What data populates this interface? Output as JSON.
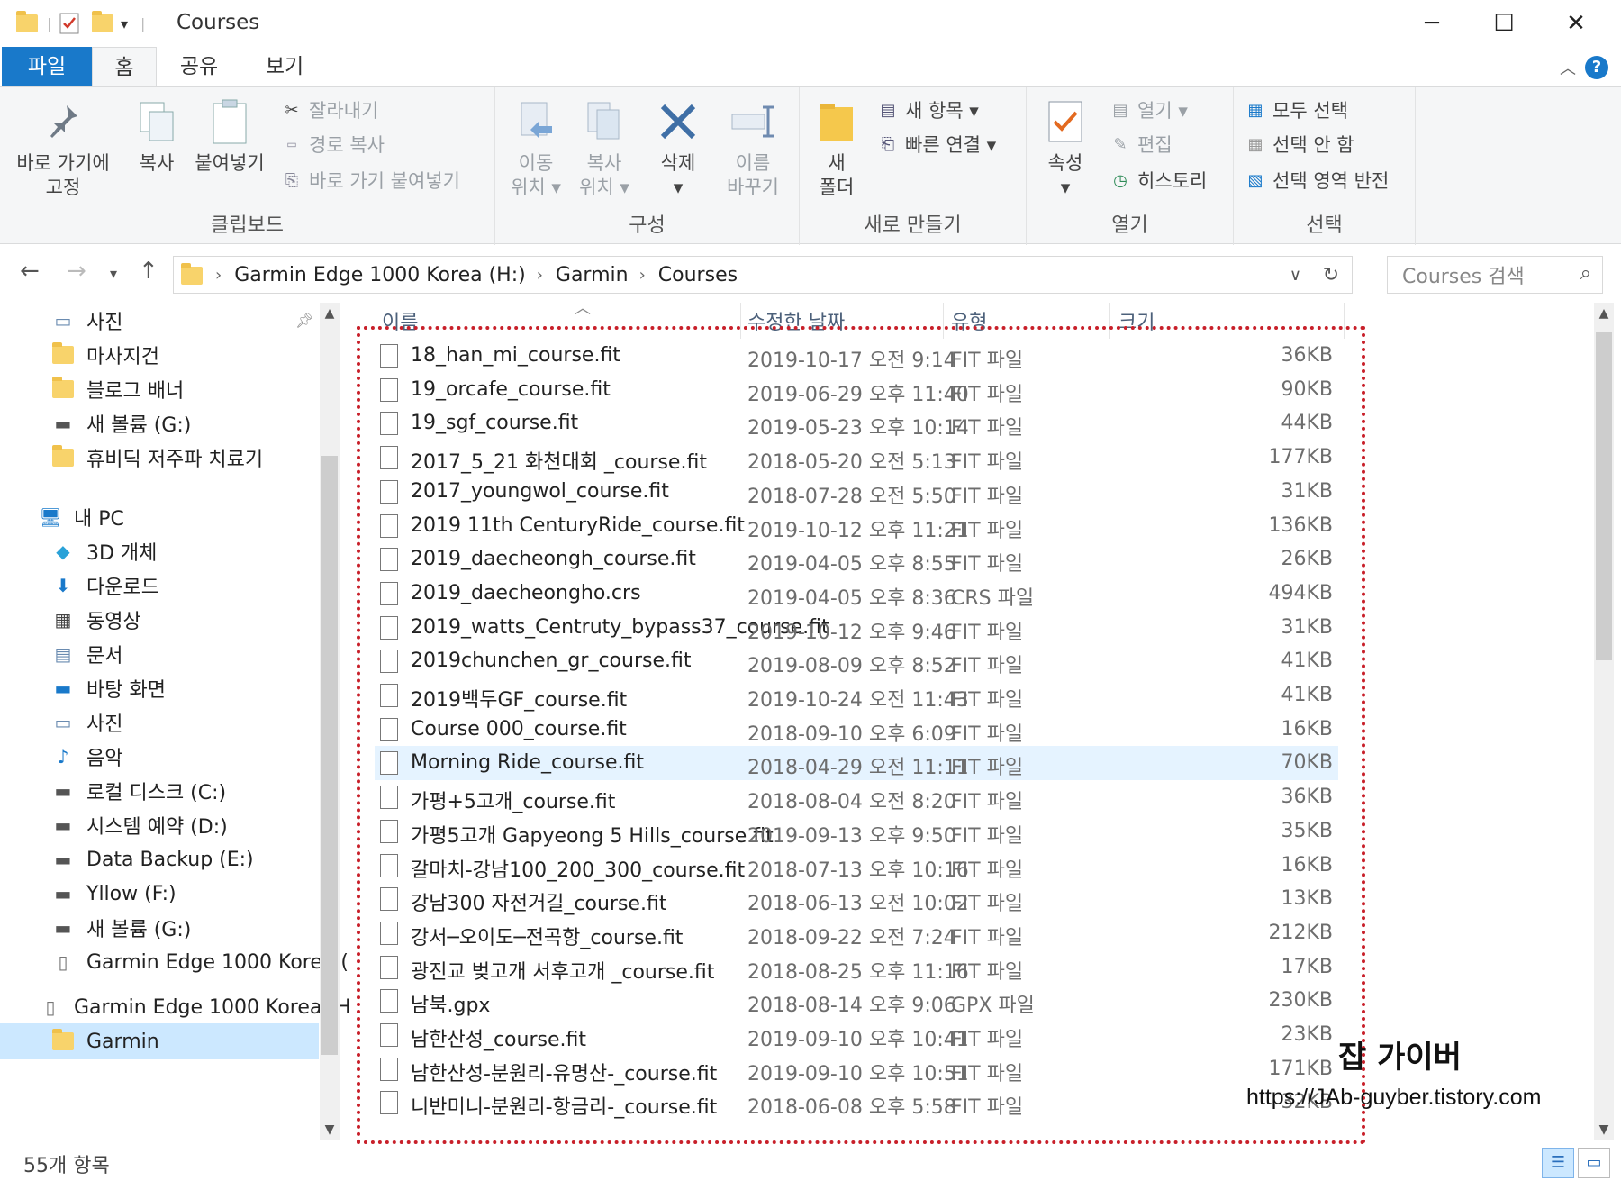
{
  "window": {
    "title": "Courses",
    "minimize": "─",
    "maximize": "☐",
    "close": "✕"
  },
  "ribbon_tabs": [
    "파일",
    "홈",
    "공유",
    "보기"
  ],
  "help_label": "?",
  "ribbon": {
    "clipboard": {
      "label": "클립보드",
      "pin": "바로 가기에\n고정",
      "copy": "복사",
      "paste": "붙여넣기",
      "cut": "잘라내기",
      "copy_path": "경로 복사",
      "paste_shortcut": "바로 가기 붙여넣기"
    },
    "organize": {
      "label": "구성",
      "move_to": "이동\n위치 ▾",
      "copy_to": "복사\n위치 ▾",
      "delete": "삭제\n▾",
      "rename": "이름\n바꾸기"
    },
    "new": {
      "label": "새로 만들기",
      "new_folder": "새\n폴더",
      "new_item": "새 항목 ▾",
      "easy_access": "빠른 연결 ▾"
    },
    "open": {
      "label": "열기",
      "properties": "속성\n▾",
      "open": "열기 ▾",
      "edit": "편집",
      "history": "히스토리"
    },
    "select": {
      "label": "선택",
      "select_all": "모두 선택",
      "select_none": "선택 안 함",
      "invert": "선택 영역 반전"
    }
  },
  "address": {
    "segments": [
      "Garmin Edge 1000 Korea (H:)",
      "Garmin",
      "Courses"
    ],
    "search_placeholder": "Courses 검색"
  },
  "nav_pane": {
    "quick_access": [
      {
        "label": "사진",
        "icon": "pictures-icon",
        "pinned": true
      },
      {
        "label": "마사지건",
        "icon": "folder-icon"
      },
      {
        "label": "블로그 배너",
        "icon": "folder-icon"
      },
      {
        "label": "새 볼륨 (G:)",
        "icon": "drive-icon"
      },
      {
        "label": "휴비딕 저주파 치료기",
        "icon": "folder-icon"
      }
    ],
    "this_pc": {
      "label": "내 PC",
      "icon": "computer-icon"
    },
    "pc_items": [
      {
        "label": "3D 개체",
        "icon": "3d-objects-icon"
      },
      {
        "label": "다운로드",
        "icon": "download-icon"
      },
      {
        "label": "동영상",
        "icon": "videos-icon"
      },
      {
        "label": "문서",
        "icon": "documents-icon"
      },
      {
        "label": "바탕 화면",
        "icon": "desktop-icon"
      },
      {
        "label": "사진",
        "icon": "pictures-icon"
      },
      {
        "label": "음악",
        "icon": "music-icon"
      },
      {
        "label": "로컬 디스크 (C:)",
        "icon": "local-disk-icon"
      },
      {
        "label": "시스템 예약 (D:)",
        "icon": "drive-icon"
      },
      {
        "label": "Data Backup (E:)",
        "icon": "drive-icon"
      },
      {
        "label": "Yllow (F:)",
        "icon": "drive-icon"
      },
      {
        "label": "새 볼륨 (G:)",
        "icon": "drive-icon"
      },
      {
        "label": "Garmin Edge 1000 Korea (",
        "icon": "usb-drive-icon"
      }
    ],
    "device": {
      "label": "Garmin Edge 1000 Korea (H",
      "icon": "usb-drive-icon"
    },
    "selected": {
      "label": "Garmin",
      "icon": "folder-icon"
    }
  },
  "columns": {
    "name": "이름",
    "date": "수정한 날짜",
    "type": "유형",
    "size": "크기"
  },
  "files": [
    {
      "name": "18_han_mi_course.fit",
      "date": "2019-10-17 오전 9:14",
      "type": "FIT 파일",
      "size": "36KB"
    },
    {
      "name": "19_orcafe_course.fit",
      "date": "2019-06-29 오후 11:40",
      "type": "FIT 파일",
      "size": "90KB"
    },
    {
      "name": "19_sgf_course.fit",
      "date": "2019-05-23 오후 10:14",
      "type": "FIT 파일",
      "size": "44KB"
    },
    {
      "name": "2017_5_21 화천대회 _course.fit",
      "date": "2018-05-20 오전 5:13",
      "type": "FIT 파일",
      "size": "177KB"
    },
    {
      "name": "2017_youngwol_course.fit",
      "date": "2018-07-28 오전 5:50",
      "type": "FIT 파일",
      "size": "31KB"
    },
    {
      "name": "2019 11th CenturyRide_course.fit",
      "date": "2019-10-12 오후 11:21",
      "type": "FIT 파일",
      "size": "136KB"
    },
    {
      "name": "2019_daecheongh_course.fit",
      "date": "2019-04-05 오후 8:55",
      "type": "FIT 파일",
      "size": "26KB"
    },
    {
      "name": "2019_daecheongho.crs",
      "date": "2019-04-05 오후 8:36",
      "type": "CRS 파일",
      "size": "494KB"
    },
    {
      "name": "2019_watts_Centruty_bypass37_course.fit",
      "date": "2019-10-12 오후 9:46",
      "type": "FIT 파일",
      "size": "31KB"
    },
    {
      "name": "2019chunchen_gr_course.fit",
      "date": "2019-08-09 오후 8:52",
      "type": "FIT 파일",
      "size": "41KB"
    },
    {
      "name": "2019백두GF_course.fit",
      "date": "2019-10-24 오전 11:43",
      "type": "FIT 파일",
      "size": "41KB"
    },
    {
      "name": "Course 000_course.fit",
      "date": "2018-09-10 오후 6:09",
      "type": "FIT 파일",
      "size": "16KB"
    },
    {
      "name": "Morning Ride_course.fit",
      "date": "2018-04-29 오전 11:11",
      "type": "FIT 파일",
      "size": "70KB",
      "hovered": true
    },
    {
      "name": "가평+5고개_course.fit",
      "date": "2018-08-04 오전 8:20",
      "type": "FIT 파일",
      "size": "36KB"
    },
    {
      "name": "가평5고개 Gapyeong 5 Hills_course.fit",
      "date": "2019-09-13 오후 9:50",
      "type": "FIT 파일",
      "size": "35KB"
    },
    {
      "name": "갈마치-강남100_200_300_course.fit",
      "date": "2018-07-13 오후 10:16",
      "type": "FIT 파일",
      "size": "16KB"
    },
    {
      "name": "강남300 자전거길_course.fit",
      "date": "2018-06-13 오전 10:02",
      "type": "FIT 파일",
      "size": "13KB"
    },
    {
      "name": "강서─오이도─전곡항_course.fit",
      "date": "2018-09-22 오전 7:24",
      "type": "FIT 파일",
      "size": "212KB"
    },
    {
      "name": "광진교 벚고개 서후고개 _course.fit",
      "date": "2018-08-25 오후 11:16",
      "type": "FIT 파일",
      "size": "17KB"
    },
    {
      "name": "남북.gpx",
      "date": "2018-08-14 오후 9:06",
      "type": "GPX 파일",
      "size": "230KB"
    },
    {
      "name": "남한산성_course.fit",
      "date": "2019-09-10 오후 10:41",
      "type": "FIT 파일",
      "size": "23KB"
    },
    {
      "name": "남한산성-분원리-유명산-_course.fit",
      "date": "2019-09-10 오후 10:51",
      "type": "FIT 파일",
      "size": "171KB"
    },
    {
      "name": "니반미니-분원리-항금리-_course.fit",
      "date": "2018-06-08 오후 5:58",
      "type": "FIT 파일",
      "size": "32KB"
    }
  ],
  "status": {
    "item_count": "55개 항목"
  },
  "watermark": {
    "title": "잡 가이버",
    "url": "https://JAb-guyber.tistory.com"
  },
  "colors": {
    "accent": "#1979ca",
    "annotation_box": "#c8202a",
    "selected_bg": "#cce8ff",
    "hover_bg": "#e5f3ff"
  }
}
